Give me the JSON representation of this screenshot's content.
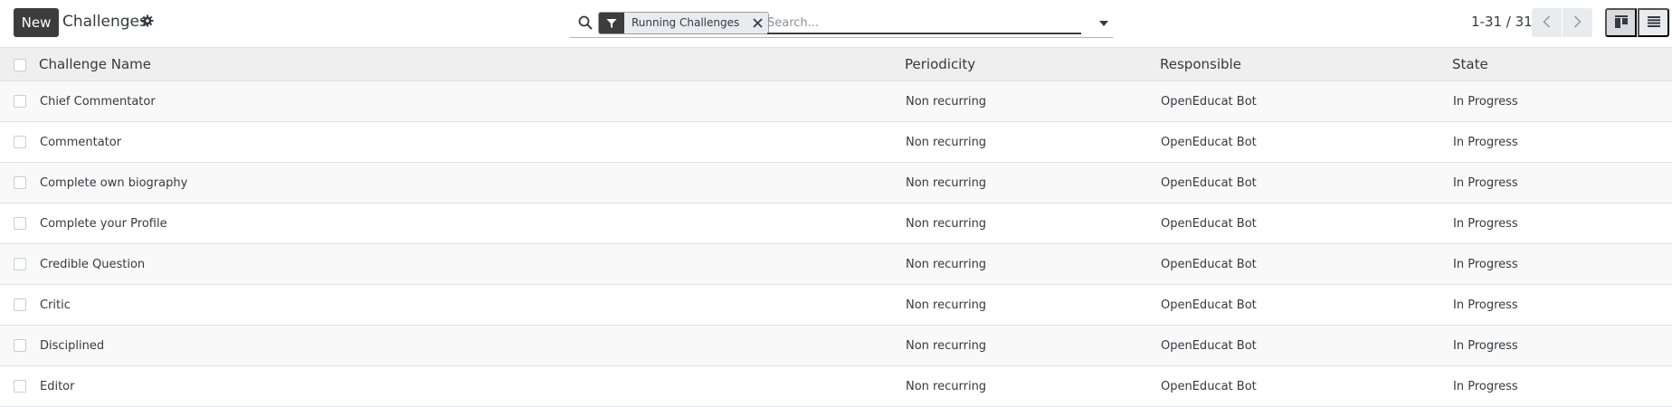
{
  "toolbar": {
    "new_label": "New",
    "title": "Challenges"
  },
  "search": {
    "facet_label": "Running Challenges",
    "placeholder": "Search..."
  },
  "pager": {
    "value": "1-31 / 31"
  },
  "table": {
    "headers": {
      "name": "Challenge Name",
      "periodicity": "Periodicity",
      "responsible": "Responsible",
      "state": "State"
    },
    "rows": [
      {
        "name": "Chief Commentator",
        "periodicity": "Non recurring",
        "responsible": "OpenEducat Bot",
        "state": "In Progress"
      },
      {
        "name": "Commentator",
        "periodicity": "Non recurring",
        "responsible": "OpenEducat Bot",
        "state": "In Progress"
      },
      {
        "name": "Complete own biography",
        "periodicity": "Non recurring",
        "responsible": "OpenEducat Bot",
        "state": "In Progress"
      },
      {
        "name": "Complete your Profile",
        "periodicity": "Non recurring",
        "responsible": "OpenEducat Bot",
        "state": "In Progress"
      },
      {
        "name": "Credible Question",
        "periodicity": "Non recurring",
        "responsible": "OpenEducat Bot",
        "state": "In Progress"
      },
      {
        "name": "Critic",
        "periodicity": "Non recurring",
        "responsible": "OpenEducat Bot",
        "state": "In Progress"
      },
      {
        "name": "Disciplined",
        "periodicity": "Non recurring",
        "responsible": "OpenEducat Bot",
        "state": "In Progress"
      },
      {
        "name": "Editor",
        "periodicity": "Non recurring",
        "responsible": "OpenEducat Bot",
        "state": "In Progress"
      }
    ]
  },
  "icons": {
    "settings": "gear-icon",
    "search": "search-icon",
    "facet": "filter-icon",
    "facet_remove": "close-icon",
    "toggle": "caret-down-icon",
    "prev": "chevron-left-icon",
    "next": "chevron-right-icon",
    "kanban_view": "kanban-view-icon",
    "list_view": "list-view-icon"
  },
  "colors": {
    "primary_button": "#3d3d3d",
    "header_background": "#efefef",
    "row_alt_background": "#f9f9f9"
  }
}
